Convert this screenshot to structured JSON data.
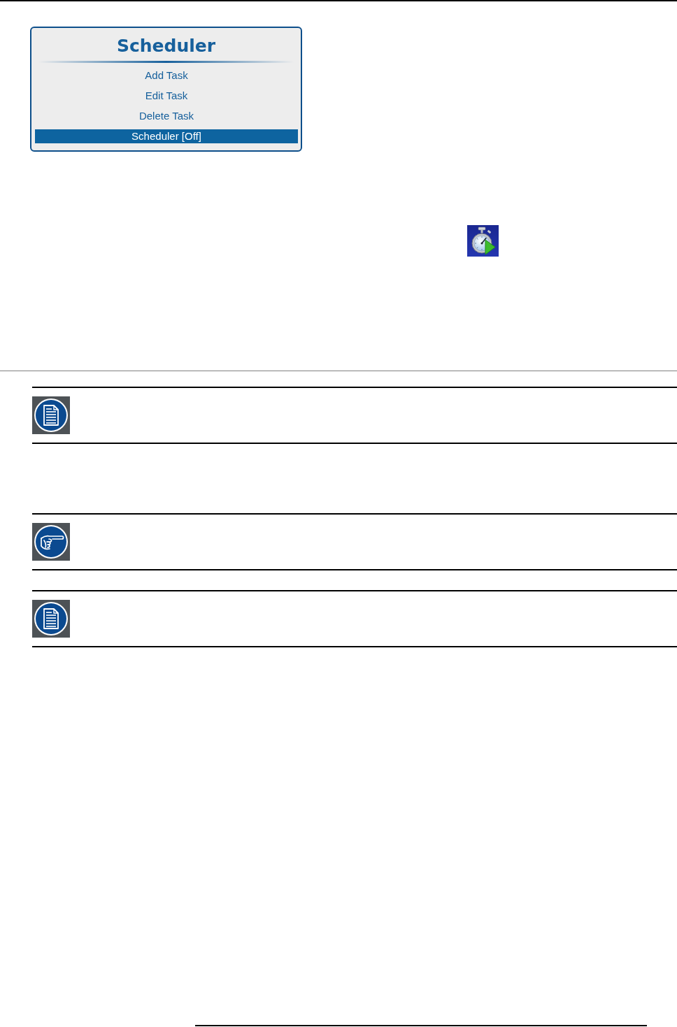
{
  "menu": {
    "title": "Scheduler",
    "items": [
      {
        "label": "Add Task",
        "selected": false
      },
      {
        "label": "Edit Task",
        "selected": false
      },
      {
        "label": "Delete Task",
        "selected": false
      },
      {
        "label": "Scheduler [Off]",
        "selected": true
      }
    ]
  },
  "notices": [
    {
      "kind": "note"
    },
    {
      "kind": "tip"
    },
    {
      "kind": "note"
    }
  ]
}
